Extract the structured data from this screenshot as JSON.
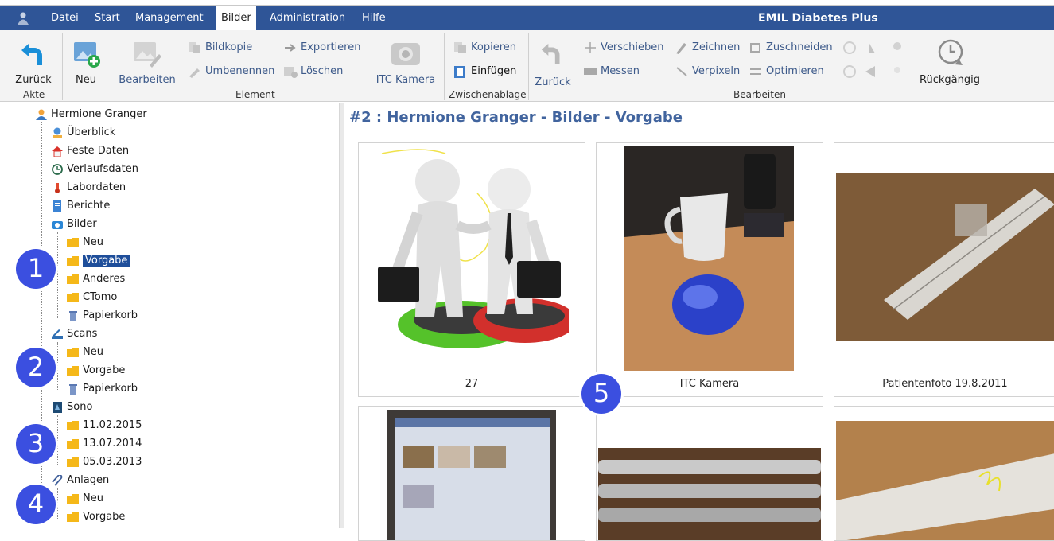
{
  "menu": {
    "items": [
      "Datei",
      "Start",
      "Management",
      "Bilder",
      "Administration",
      "Hilfe"
    ],
    "active": "Bilder",
    "app_title": "EMIL Diabetes Plus"
  },
  "ribbon": {
    "back": "Zurück",
    "group_akte": "Akte",
    "new": "Neu",
    "edit": "Bearbeiten",
    "copy_image": "Bildkopie",
    "rename": "Umbenennen",
    "export": "Exportieren",
    "delete": "Löschen",
    "group_element": "Element",
    "itc_camera": "ITC Kamera",
    "copy": "Kopieren",
    "paste": "Einfügen",
    "group_clipboard": "Zwischenablage",
    "back2": "Zurück",
    "move": "Verschieben",
    "measure": "Messen",
    "draw": "Zeichnen",
    "pixelate": "Verpixeln",
    "crop": "Zuschneiden",
    "optimize": "Optimieren",
    "undo": "Rückgängig",
    "group_edit": "Bearbeiten"
  },
  "tree": {
    "patient": "Hermione Granger",
    "overview": "Überblick",
    "fixed": "Feste Daten",
    "history": "Verlaufsdaten",
    "lab": "Labordaten",
    "reports": "Berichte",
    "images": "Bilder",
    "img_new": "Neu",
    "img_default": "Vorgabe",
    "img_other": "Anderes",
    "img_ctomo": "CTomo",
    "img_trash": "Papierkorb",
    "scans": "Scans",
    "scan_new": "Neu",
    "scan_default": "Vorgabe",
    "scan_trash": "Papierkorb",
    "sono": "Sono",
    "sono_1": "11.02.2015",
    "sono_2": "13.07.2014",
    "sono_3": "05.03.2013",
    "attachments": "Anlagen",
    "att_new": "Neu",
    "att_default": "Vorgabe"
  },
  "badges": [
    "1",
    "2",
    "3",
    "4",
    "5"
  ],
  "main": {
    "title": "#2 : Hermione Granger - Bilder - Vorgabe",
    "cards": [
      "27",
      "ITC Kamera",
      "Patientenfoto 19.8.2011"
    ]
  }
}
